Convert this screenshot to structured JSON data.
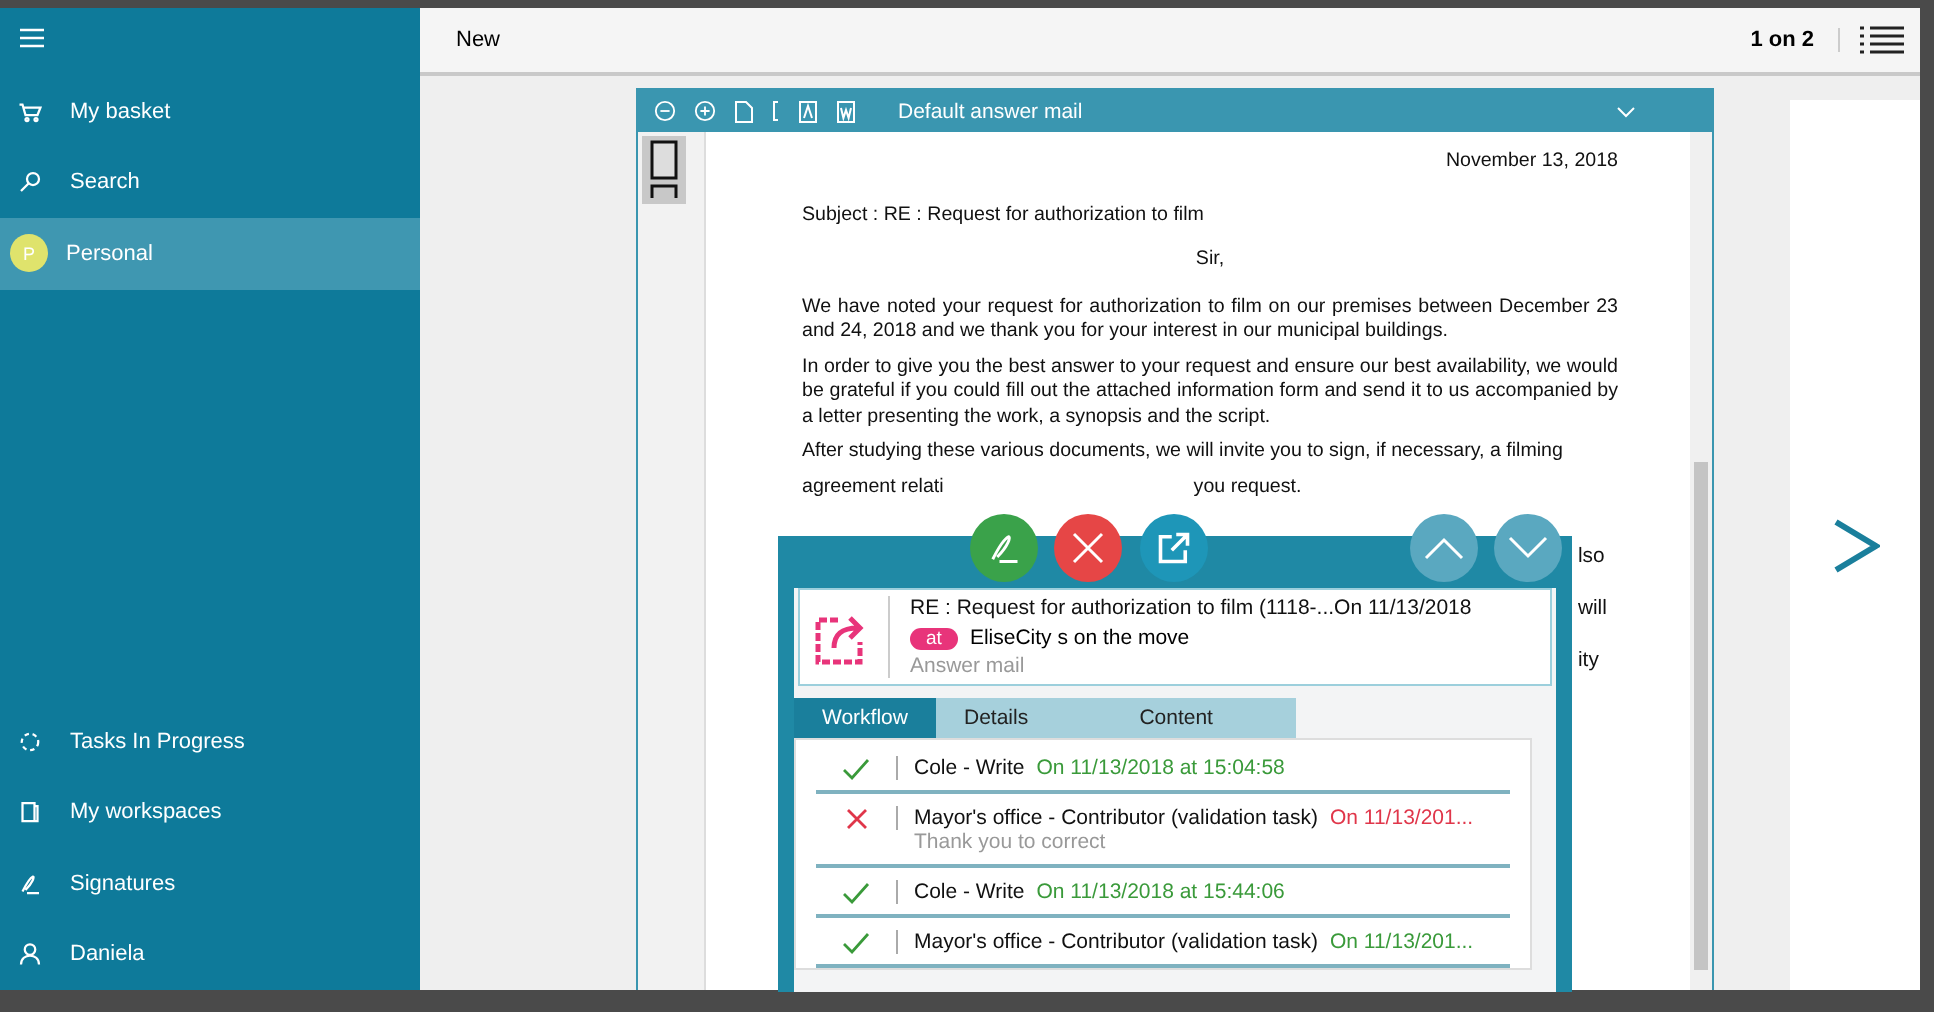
{
  "sidebar": {
    "items": [
      {
        "kind": "basket",
        "label": "My basket",
        "selected": false
      },
      {
        "kind": "search",
        "label": "Search",
        "selected": false
      },
      {
        "kind": "avatar",
        "avatar_letter": "P",
        "label": "Personal",
        "selected": true
      }
    ],
    "bottom_items": [
      {
        "kind": "tasks",
        "label": "Tasks In Progress",
        "selected": false
      },
      {
        "kind": "workspaces",
        "label": "My workspaces",
        "selected": false
      },
      {
        "kind": "signature",
        "label": "Signatures",
        "selected": false
      },
      {
        "kind": "user",
        "label": "Daniela",
        "selected": false
      }
    ]
  },
  "header": {
    "title": "New",
    "page_counter": "1 on 2"
  },
  "viewer": {
    "title": "Default answer mail",
    "document": {
      "date": "November 13, 2018",
      "subject": "Subject : RE : Request for authorization to film",
      "salutation": "Sir,",
      "paragraphs": [
        "We have noted your request for authorization to film on our premises between December 23 and 24, 2018 and we thank you for your interest in our municipal buildings.",
        "In order to give you the best answer to your request and ensure our best availability, we would be grateful if you could fill out the attached information form and send it to us accompanied by a letter presenting the work, a synopsis and the script.",
        "After studying these various documents, we will invite you to sign, if necessary, a filming"
      ],
      "partial_line": [
        "agreement relati",
        "you request."
      ],
      "edge_fragments": [
        "lso",
        "will",
        "ity"
      ]
    }
  },
  "task_panel": {
    "mail": {
      "title": "RE : Request for authorization to film (1118-...On 11/13/2018",
      "tag": "at",
      "sender": "EliseCity s on the move",
      "type": "Answer mail"
    },
    "tabs": [
      {
        "label": "Workflow",
        "selected": true
      },
      {
        "label": "Details",
        "selected": false
      },
      {
        "label": "Content",
        "selected": false
      }
    ],
    "workflow": [
      {
        "kind": "done",
        "name": "Cole - Write",
        "date": "On 11/13/2018 at 15:04:58"
      },
      {
        "kind": "rejected",
        "name": "Mayor's office - Contributor (validation task)",
        "date": "On 11/13/201...",
        "comment": "Thank you to correct"
      },
      {
        "kind": "done",
        "name": "Cole - Write",
        "date": "On 11/13/2018 at 15:44:06"
      },
      {
        "kind": "done",
        "name": "Mayor's office - Contributor (validation task)",
        "date": "On 11/13/201..."
      }
    ]
  }
}
